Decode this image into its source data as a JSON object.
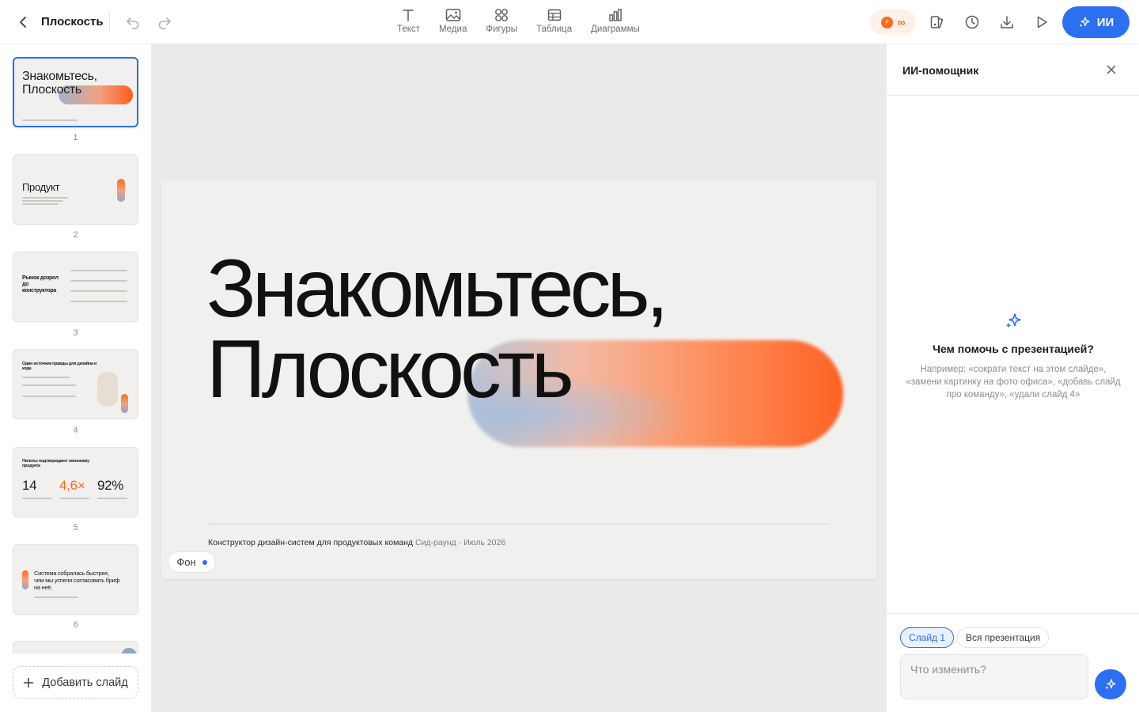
{
  "app": {
    "title": "Плоскость",
    "accent_color": "#2b6ff2",
    "brand_orange": "#ff6a1a"
  },
  "toolbar": {
    "back_icon": "chevron-left-icon",
    "undo_icon": "undo-icon",
    "redo_icon": "redo-icon",
    "tools": [
      {
        "label": "Текст",
        "icon": "text-icon"
      },
      {
        "label": "Медиа",
        "icon": "image-icon"
      },
      {
        "label": "Фигуры",
        "icon": "shapes-icon"
      },
      {
        "label": "Таблица",
        "icon": "table-icon"
      },
      {
        "label": "Диаграммы",
        "icon": "chart-icon"
      }
    ],
    "credits_symbol": "∞",
    "right_icons": [
      "theme-icon",
      "history-icon",
      "download-icon",
      "play-icon"
    ],
    "ai_button_label": "ИИ"
  },
  "sidebar": {
    "slides": [
      {
        "num": "1",
        "title_line1": "Знакомьтесь,",
        "title_line2": "Плоскость"
      },
      {
        "num": "2",
        "title": "Продукт"
      },
      {
        "num": "3",
        "title_line1": "Рынок дозрел",
        "title_line2": "до",
        "title_line3": "конструктора"
      },
      {
        "num": "4",
        "title_line1": "Один источник правды для дизайна и",
        "title_line2": "кода"
      },
      {
        "num": "5",
        "title_line1": "Пилоты подтверждают экономику",
        "title_line2": "продукта",
        "stat1": "14",
        "stat2": "4,6×",
        "stat3": "92%"
      },
      {
        "num": "6",
        "quote_line1": "Система собралась быстрее,",
        "quote_line2": "чем мы успели согласовать бриф",
        "quote_line3": "на неё."
      }
    ],
    "add_slide_label": "Добавить слайд"
  },
  "slide": {
    "title_line1": "Знакомьтесь,",
    "title_line2": "Плоскость",
    "footer_main": "Конструктор дизайн-систем для продуктовых команд",
    "footer_muted": "Сид-раунд · Июль 2026",
    "background_chip": "Фон"
  },
  "assistant": {
    "title": "ИИ-помощник",
    "question": "Чем помочь с презентацией?",
    "hint": "Например: «сократи текст на этом слайде», «замени картинку на фото офиса», «добавь слайд про команду», «удали слайд 4»",
    "scope_current": "Слайд 1",
    "scope_all": "Вся презентация",
    "input_placeholder": "Что изменить?"
  }
}
